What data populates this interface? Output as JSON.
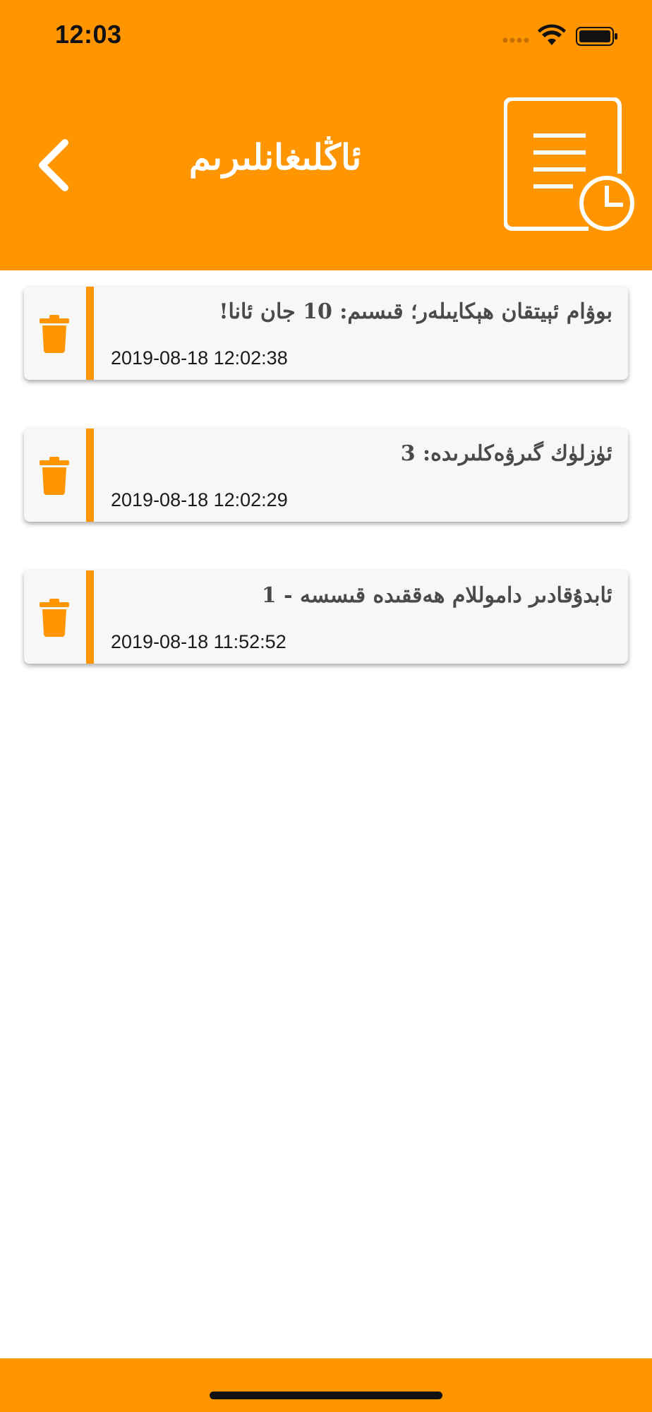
{
  "status_bar": {
    "time": "12:03"
  },
  "header": {
    "title": "ئاڭلىغانلىرىم",
    "back_icon": "chevron-left-icon",
    "decor_icon": "document-history-icon",
    "background_color": "#FF9500"
  },
  "history": {
    "items": [
      {
        "title": "بوۋام ئېيتقان ھېكايىلەر؛ قىسىم: 10 جان ئانا!",
        "timestamp": "2019-08-18 12:02:38"
      },
      {
        "title": "ئۈزلۈك گىرۋەكلىرىدە: 3",
        "timestamp": "2019-08-18 12:02:29"
      },
      {
        "title": "ئابدۇقادىر داموللام ھەققىدە قىسسە - 1",
        "timestamp": "2019-08-18 11:52:52"
      }
    ],
    "delete_icon": "trash-icon",
    "accent_color": "#FF9500"
  }
}
